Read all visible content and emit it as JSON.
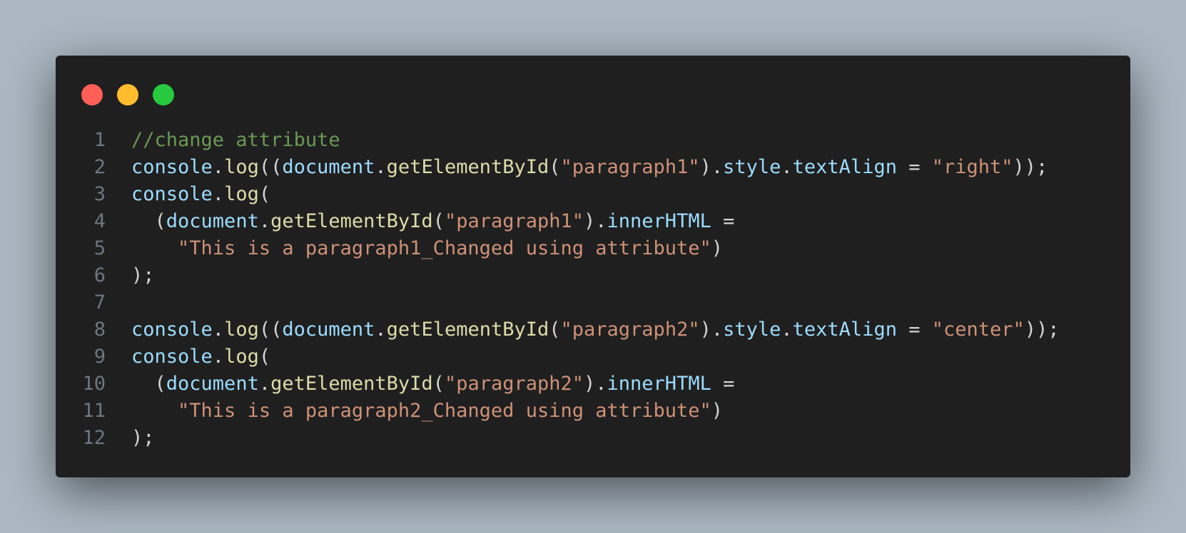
{
  "window": {
    "controls": [
      {
        "name": "close",
        "color": "#ff5f56"
      },
      {
        "name": "minimize",
        "color": "#ffbd2e"
      },
      {
        "name": "maximize",
        "color": "#27c93f"
      }
    ]
  },
  "theme": {
    "comment": "#6a9955",
    "variable": "#9cdcfe",
    "function": "#dcdcaa",
    "string": "#ce9178",
    "punctuation": "#d4d4d4",
    "line_number": "#6e7681",
    "background": "#1f1f1f",
    "page_background": "#abb8c3"
  },
  "code": {
    "language": "javascript",
    "lines": [
      {
        "number": "1",
        "tokens": [
          {
            "t": "//change attribute",
            "k": "comment"
          }
        ]
      },
      {
        "number": "2",
        "tokens": [
          {
            "t": "console",
            "k": "variable"
          },
          {
            "t": ".",
            "k": "punctuation"
          },
          {
            "t": "log",
            "k": "function"
          },
          {
            "t": "((",
            "k": "punctuation"
          },
          {
            "t": "document",
            "k": "variable"
          },
          {
            "t": ".",
            "k": "punctuation"
          },
          {
            "t": "getElementById",
            "k": "function"
          },
          {
            "t": "(",
            "k": "punctuation"
          },
          {
            "t": "\"paragraph1\"",
            "k": "string"
          },
          {
            "t": ").",
            "k": "punctuation"
          },
          {
            "t": "style",
            "k": "variable"
          },
          {
            "t": ".",
            "k": "punctuation"
          },
          {
            "t": "textAlign",
            "k": "variable"
          },
          {
            "t": " = ",
            "k": "punctuation"
          },
          {
            "t": "\"right\"",
            "k": "string"
          },
          {
            "t": "));",
            "k": "punctuation"
          }
        ]
      },
      {
        "number": "3",
        "tokens": [
          {
            "t": "console",
            "k": "variable"
          },
          {
            "t": ".",
            "k": "punctuation"
          },
          {
            "t": "log",
            "k": "function"
          },
          {
            "t": "(",
            "k": "punctuation"
          }
        ]
      },
      {
        "number": "4",
        "tokens": [
          {
            "t": "  (",
            "k": "punctuation"
          },
          {
            "t": "document",
            "k": "variable"
          },
          {
            "t": ".",
            "k": "punctuation"
          },
          {
            "t": "getElementById",
            "k": "function"
          },
          {
            "t": "(",
            "k": "punctuation"
          },
          {
            "t": "\"paragraph1\"",
            "k": "string"
          },
          {
            "t": ").",
            "k": "punctuation"
          },
          {
            "t": "innerHTML",
            "k": "variable"
          },
          {
            "t": " =",
            "k": "punctuation"
          }
        ]
      },
      {
        "number": "5",
        "tokens": [
          {
            "t": "    ",
            "k": "punctuation"
          },
          {
            "t": "\"This is a paragraph1_Changed using attribute\"",
            "k": "string"
          },
          {
            "t": ")",
            "k": "punctuation"
          }
        ]
      },
      {
        "number": "6",
        "tokens": [
          {
            "t": ");",
            "k": "punctuation"
          }
        ]
      },
      {
        "number": "7",
        "tokens": []
      },
      {
        "number": "8",
        "tokens": [
          {
            "t": "console",
            "k": "variable"
          },
          {
            "t": ".",
            "k": "punctuation"
          },
          {
            "t": "log",
            "k": "function"
          },
          {
            "t": "((",
            "k": "punctuation"
          },
          {
            "t": "document",
            "k": "variable"
          },
          {
            "t": ".",
            "k": "punctuation"
          },
          {
            "t": "getElementById",
            "k": "function"
          },
          {
            "t": "(",
            "k": "punctuation"
          },
          {
            "t": "\"paragraph2\"",
            "k": "string"
          },
          {
            "t": ").",
            "k": "punctuation"
          },
          {
            "t": "style",
            "k": "variable"
          },
          {
            "t": ".",
            "k": "punctuation"
          },
          {
            "t": "textAlign",
            "k": "variable"
          },
          {
            "t": " = ",
            "k": "punctuation"
          },
          {
            "t": "\"center\"",
            "k": "string"
          },
          {
            "t": "));",
            "k": "punctuation"
          }
        ]
      },
      {
        "number": "9",
        "tokens": [
          {
            "t": "console",
            "k": "variable"
          },
          {
            "t": ".",
            "k": "punctuation"
          },
          {
            "t": "log",
            "k": "function"
          },
          {
            "t": "(",
            "k": "punctuation"
          }
        ]
      },
      {
        "number": "10",
        "tokens": [
          {
            "t": "  (",
            "k": "punctuation"
          },
          {
            "t": "document",
            "k": "variable"
          },
          {
            "t": ".",
            "k": "punctuation"
          },
          {
            "t": "getElementById",
            "k": "function"
          },
          {
            "t": "(",
            "k": "punctuation"
          },
          {
            "t": "\"paragraph2\"",
            "k": "string"
          },
          {
            "t": ").",
            "k": "punctuation"
          },
          {
            "t": "innerHTML",
            "k": "variable"
          },
          {
            "t": " =",
            "k": "punctuation"
          }
        ]
      },
      {
        "number": "11",
        "tokens": [
          {
            "t": "    ",
            "k": "punctuation"
          },
          {
            "t": "\"This is a paragraph2_Changed using attribute\"",
            "k": "string"
          },
          {
            "t": ")",
            "k": "punctuation"
          }
        ]
      },
      {
        "number": "12",
        "tokens": [
          {
            "t": ");",
            "k": "punctuation"
          }
        ]
      }
    ]
  }
}
